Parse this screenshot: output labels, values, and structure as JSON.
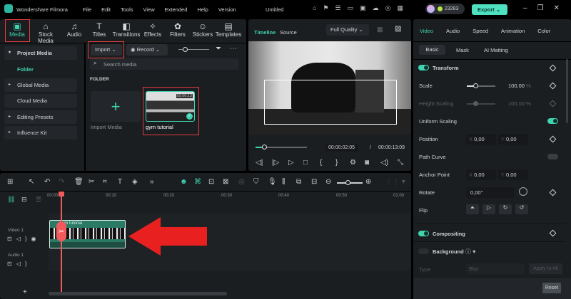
{
  "titlebar": {
    "app": "Wondershare Filmora",
    "menu": [
      "File",
      "Edit",
      "Tools",
      "View",
      "Extended",
      "Help",
      "Version"
    ],
    "project": "Untitled",
    "credits": "23283",
    "export": "Export"
  },
  "toolbar_tabs": [
    {
      "label": "Media",
      "icon": "media-icon"
    },
    {
      "label": "Stock Media",
      "icon": "stock-icon"
    },
    {
      "label": "Audio",
      "icon": "music-icon"
    },
    {
      "label": "Titles",
      "icon": "text-icon"
    },
    {
      "label": "Transitions",
      "icon": "transition-icon"
    },
    {
      "label": "Effects",
      "icon": "effects-icon"
    },
    {
      "label": "Filters",
      "icon": "filters-icon"
    },
    {
      "label": "Stickers",
      "icon": "sticker-icon"
    },
    {
      "label": "Templates",
      "icon": "template-icon"
    }
  ],
  "sidebar": {
    "items": [
      "Project Media",
      "Folder",
      "Global Media",
      "Cloud Media",
      "Editing Presets",
      "Influence Kit"
    ]
  },
  "media": {
    "import": "Import",
    "record": "Record",
    "search_placeholder": "Search media",
    "folder_heading": "FOLDER",
    "import_media": "Import Media",
    "clip_name": "gym tutorial",
    "clip_duration": "00:00:13"
  },
  "preview": {
    "tab_timeline": "Timeline",
    "tab_source": "Source",
    "quality": "Full Quality",
    "current_time": "00:00:02:05",
    "separator": "/",
    "total_time": "00:00:13:09",
    "progress": 0.16
  },
  "inspector": {
    "tabs": [
      "Video",
      "Audio",
      "Speed",
      "Animation",
      "Color"
    ],
    "subtabs": [
      "Basic",
      "Mask",
      "AI Matting"
    ],
    "transform": "Transform",
    "scale_label": "Scale",
    "scale_value": "100,00",
    "pct": "%",
    "height_label": "Height Scaling",
    "height_value": "100,00",
    "uniform": "Uniform Scaling",
    "position": "Position",
    "x": "X",
    "y": "Y",
    "pos_x": "0,00",
    "pos_y": "0,00",
    "path_curve": "Path Curve",
    "anchor": "Anchor Point",
    "anc_x": "0,00",
    "anc_y": "0,00",
    "rotate": "Rotate",
    "rotate_value": "0,00°",
    "flip": "Flip",
    "compositing": "Compositing",
    "background": "Background",
    "type": "Type",
    "type_value": "Blur",
    "apply_all": "Apply to All",
    "reset": "Reset"
  },
  "timeline": {
    "ruler": [
      "00:00",
      "00:10",
      "00:20",
      "00:30",
      "00:40",
      "00:50",
      "01:00"
    ],
    "tracks": [
      "Video 1",
      "Audio 1"
    ],
    "clip": "gym tutorial"
  },
  "colors": {
    "accent": "#3fd3b0",
    "annotation": "#e23b3b"
  }
}
